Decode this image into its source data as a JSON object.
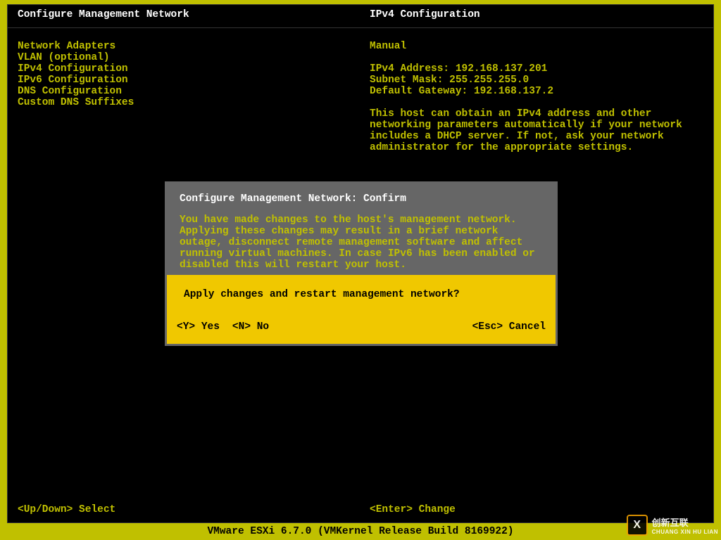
{
  "header": {
    "left": "Configure Management Network",
    "right": "IPv4 Configuration"
  },
  "menu": {
    "items": [
      "Network Adapters",
      "VLAN (optional)",
      "",
      "IPv4 Configuration",
      "IPv6 Configuration",
      "DNS Configuration",
      "Custom DNS Suffixes"
    ]
  },
  "detail": {
    "mode": "Manual",
    "ipv4_label": "IPv4 Address:",
    "ipv4_value": "192.168.137.201",
    "mask_label": "Subnet Mask:",
    "mask_value": "255.255.255.0",
    "gw_label": "Default Gateway:",
    "gw_value": "192.168.137.2",
    "description": "This host can obtain an IPv4 address and other networking parameters automatically if your network includes a DHCP server. If not, ask your network administrator for the appropriate settings."
  },
  "dialog": {
    "title": "Configure Management Network: Confirm",
    "message": "You have made changes to the host's management network. Applying these changes may result in a brief network outage, disconnect remote management software and affect running virtual machines. In case IPv6 has been enabled or disabled this will restart your host.",
    "question": "Apply changes and restart management network?",
    "yes_key": "<Y>",
    "yes_label": "Yes",
    "no_key": "<N>",
    "no_label": "No",
    "esc_key": "<Esc>",
    "esc_label": "Cancel"
  },
  "hints": {
    "updown_key": "<Up/Down>",
    "updown_label": "Select",
    "enter_key": "<Enter>",
    "enter_label": "Change"
  },
  "footer": {
    "text": "VMware ESXi 6.7.0 (VMKernel Release Build 8169922)"
  },
  "watermark": {
    "logo_text": "X",
    "text_top": "创新互联",
    "text_bottom": "CHUANG XIN HU LIAN"
  }
}
